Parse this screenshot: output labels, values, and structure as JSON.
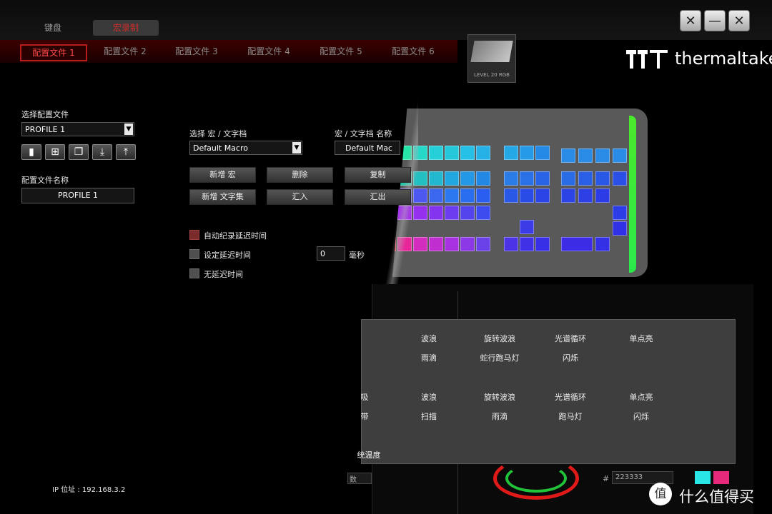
{
  "top_tabs": [
    "键盘",
    "宏录制"
  ],
  "profile_tabs": [
    "配置文件 1",
    "配置文件 2",
    "配置文件 3",
    "配置文件 4",
    "配置文件 5",
    "配置文件 6"
  ],
  "brand": {
    "logo_text": "thermaltake",
    "product_label": "LEVEL 20 RGB"
  },
  "window_controls": {
    "tools": "tools-icon",
    "minimize": "minimize-icon",
    "close": "close-icon"
  },
  "left": {
    "select_profile_label": "选择配置文件",
    "profile_select_value": "PROFILE 1",
    "profile_name_label": "配置文件名称",
    "profile_name_value": "PROFILE 1",
    "ip": "IP 位址 : 192.168.3.2"
  },
  "macro": {
    "select_label": "选择 宏 / 文字档",
    "select_value": "Default Macro",
    "name_label": "宏 / 文字档 名称",
    "name_value": "Default Mac",
    "buttons": [
      "新增 宏",
      "删除",
      "复制",
      "新增 文字集",
      "汇入",
      "汇出"
    ],
    "options": [
      "自动纪录延迟时间",
      "设定延迟时间",
      "无延迟时间"
    ],
    "delay_value": "0",
    "delay_unit": "毫秒"
  },
  "effects": {
    "row1": [
      "波浪",
      "旋转波浪",
      "光谱循环",
      "单点亮"
    ],
    "row2": [
      "雨滴",
      "蛇行跑马灯",
      "闪烁"
    ],
    "row3_partial": "吸",
    "row3": [
      "波浪",
      "旋转波浪",
      "光谱循环",
      "单点亮"
    ],
    "row4_partial": "带",
    "row4": [
      "扫描",
      "雨滴",
      "跑马灯",
      "闪烁"
    ],
    "temp_label": "统温度",
    "temp_partial": "数",
    "hash_label": "#",
    "hash_value": "223333"
  },
  "watermark": {
    "symbol": "值",
    "text": "什么值得买"
  },
  "colors": {
    "accent_red": "#d12b2b",
    "bg": "#000000",
    "panel": "#3e3e3e"
  }
}
